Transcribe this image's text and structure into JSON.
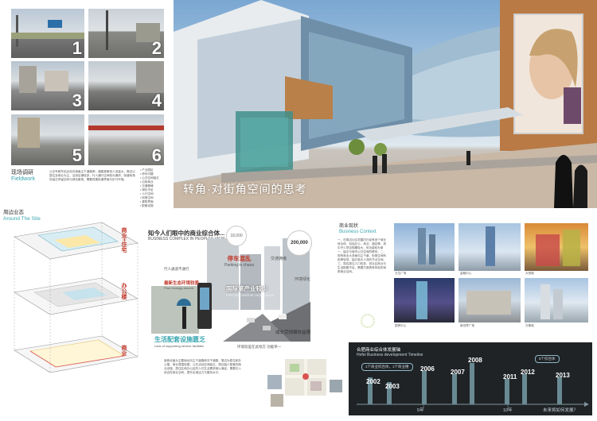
{
  "fieldwork": {
    "title_cn": "现场调研",
    "title_en": "Fieldwork",
    "photo_numbers": [
      "1",
      "2",
      "3",
      "4",
      "5",
      "6"
    ],
    "paragraph": "公交车候车站点设在南面主干道路旁，道路宽敞但人流量大，周边以居住及商业为主，沿街店铺较多，行人通行空间较为拥挤，街道转角处缺乏停留空间与绿化景观，需要改善街道界面与步行环境。",
    "notes": [
      "• 产业园区",
      "• 停车问题",
      "• 公共空间缺乏",
      "• 沿街商业",
      "• 交通拥堵",
      "• 绿化不足",
      "• 人行空间",
      "• 街角空间",
      "• 建筑界面",
      "• 配套设施"
    ]
  },
  "hero": {
    "caption": "转角·对街角空间的思考"
  },
  "site": {
    "title_cn": "周边业态",
    "title_en": "Around The Site",
    "layer_labels": [
      "商业+住宅",
      "办公楼",
      "商业"
    ]
  },
  "center": {
    "heading_cn": "知今人们眼中的商业综合体...",
    "heading_en": "BUSINESS COMPLEX IN PEOPLES VIEW...",
    "bubble_values": [
      "18,000",
      "200,000"
    ],
    "labels": {
      "parking_cn": "停车混乱",
      "parking_en": "Parking in chaos",
      "intl_cn": "国际第产业较少",
      "intl_en": "Few international corporations",
      "ecology_cn": "最新生态环境较差",
      "ecology_en": "Poor ecology around",
      "support_cn": "生活配套设施匮乏",
      "support_en": "Lack of supporting service facilities",
      "cost_cn": "成长受规模效益限",
      "pedestrian_cn": "行人通道不通行",
      "traffic_cn": "交通拥堵",
      "greening_cn": "环境绿化",
      "bottom_cn": "环境较差在此地方 功能单一"
    },
    "paragraph": "南侧北面为主要南北向主干道路和次干道路，周边为居住和办公楼，商业氛围较弱，公共活动空间缺乏。周边缺少配套的商业设施，居住区和办公区的人们生活需求难以满足，需要引入综合性商业空间，提升区域活力与服务水平。"
  },
  "business": {
    "title_cn": "商业现状",
    "title_en": "Business Context",
    "paragraph": "一、在周边片区范围内已经有多个商业综合体，包括办公、商业、酒店等，其中不少项目规模较大，但功能较为单一，缺乏与城市公共空间的联系。二、现有商业大多面向主干道，街角空间利用率较低，缺乏吸引人流的节点空间。三、周边居住人口较多，但社区商业与生活配套不足，需要打造具有特色的街角商业空间。",
    "photo_captions": [
      "万达广场",
      "金融中心",
      "大悦城",
      "国贸中心",
      "新世界广场",
      "万象城"
    ]
  },
  "timeline": {
    "title_cn": "合肥商业综合体发展轴",
    "title_en": "Hefei Business development Timeline",
    "years": [
      "2002",
      "2003",
      "2006",
      "2007",
      "2008",
      "2011",
      "2012",
      "2013"
    ],
    "tag_left": "1个商业综合体，1个商业楼",
    "tag_right": "5个综合体",
    "axis_labels": [
      "5年",
      "10年",
      "未来将如何发展？"
    ]
  }
}
